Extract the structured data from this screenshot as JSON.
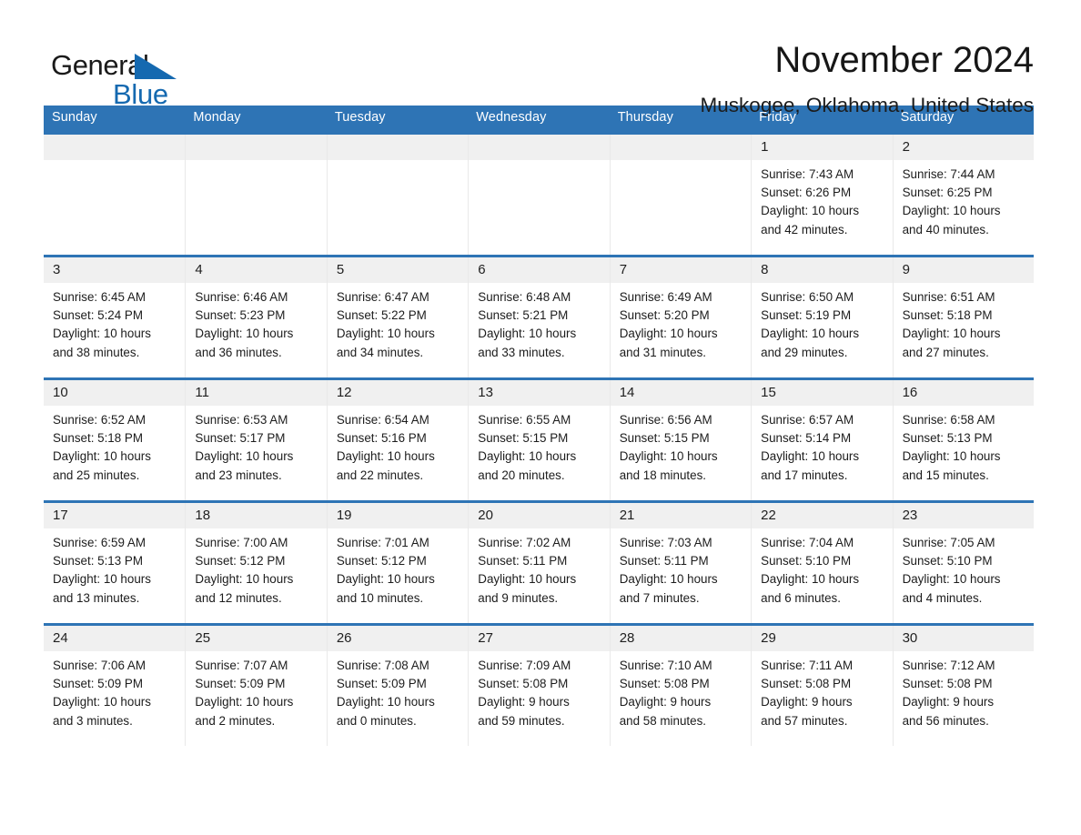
{
  "brand": {
    "name_part1": "General",
    "name_part2": "Blue",
    "accent_color": "#1569b0"
  },
  "header": {
    "title": "November 2024",
    "location": "Muskogee, Oklahoma, United States",
    "header_bg_color": "#2e74b5",
    "daynum_band_color": "#f0f0f0"
  },
  "weekdays": [
    "Sunday",
    "Monday",
    "Tuesday",
    "Wednesday",
    "Thursday",
    "Friday",
    "Saturday"
  ],
  "weeks": [
    [
      {
        "day": "",
        "sunrise": "",
        "sunset": "",
        "daylight1": "",
        "daylight2": ""
      },
      {
        "day": "",
        "sunrise": "",
        "sunset": "",
        "daylight1": "",
        "daylight2": ""
      },
      {
        "day": "",
        "sunrise": "",
        "sunset": "",
        "daylight1": "",
        "daylight2": ""
      },
      {
        "day": "",
        "sunrise": "",
        "sunset": "",
        "daylight1": "",
        "daylight2": ""
      },
      {
        "day": "",
        "sunrise": "",
        "sunset": "",
        "daylight1": "",
        "daylight2": ""
      },
      {
        "day": "1",
        "sunrise": "Sunrise: 7:43 AM",
        "sunset": "Sunset: 6:26 PM",
        "daylight1": "Daylight: 10 hours",
        "daylight2": "and 42 minutes."
      },
      {
        "day": "2",
        "sunrise": "Sunrise: 7:44 AM",
        "sunset": "Sunset: 6:25 PM",
        "daylight1": "Daylight: 10 hours",
        "daylight2": "and 40 minutes."
      }
    ],
    [
      {
        "day": "3",
        "sunrise": "Sunrise: 6:45 AM",
        "sunset": "Sunset: 5:24 PM",
        "daylight1": "Daylight: 10 hours",
        "daylight2": "and 38 minutes."
      },
      {
        "day": "4",
        "sunrise": "Sunrise: 6:46 AM",
        "sunset": "Sunset: 5:23 PM",
        "daylight1": "Daylight: 10 hours",
        "daylight2": "and 36 minutes."
      },
      {
        "day": "5",
        "sunrise": "Sunrise: 6:47 AM",
        "sunset": "Sunset: 5:22 PM",
        "daylight1": "Daylight: 10 hours",
        "daylight2": "and 34 minutes."
      },
      {
        "day": "6",
        "sunrise": "Sunrise: 6:48 AM",
        "sunset": "Sunset: 5:21 PM",
        "daylight1": "Daylight: 10 hours",
        "daylight2": "and 33 minutes."
      },
      {
        "day": "7",
        "sunrise": "Sunrise: 6:49 AM",
        "sunset": "Sunset: 5:20 PM",
        "daylight1": "Daylight: 10 hours",
        "daylight2": "and 31 minutes."
      },
      {
        "day": "8",
        "sunrise": "Sunrise: 6:50 AM",
        "sunset": "Sunset: 5:19 PM",
        "daylight1": "Daylight: 10 hours",
        "daylight2": "and 29 minutes."
      },
      {
        "day": "9",
        "sunrise": "Sunrise: 6:51 AM",
        "sunset": "Sunset: 5:18 PM",
        "daylight1": "Daylight: 10 hours",
        "daylight2": "and 27 minutes."
      }
    ],
    [
      {
        "day": "10",
        "sunrise": "Sunrise: 6:52 AM",
        "sunset": "Sunset: 5:18 PM",
        "daylight1": "Daylight: 10 hours",
        "daylight2": "and 25 minutes."
      },
      {
        "day": "11",
        "sunrise": "Sunrise: 6:53 AM",
        "sunset": "Sunset: 5:17 PM",
        "daylight1": "Daylight: 10 hours",
        "daylight2": "and 23 minutes."
      },
      {
        "day": "12",
        "sunrise": "Sunrise: 6:54 AM",
        "sunset": "Sunset: 5:16 PM",
        "daylight1": "Daylight: 10 hours",
        "daylight2": "and 22 minutes."
      },
      {
        "day": "13",
        "sunrise": "Sunrise: 6:55 AM",
        "sunset": "Sunset: 5:15 PM",
        "daylight1": "Daylight: 10 hours",
        "daylight2": "and 20 minutes."
      },
      {
        "day": "14",
        "sunrise": "Sunrise: 6:56 AM",
        "sunset": "Sunset: 5:15 PM",
        "daylight1": "Daylight: 10 hours",
        "daylight2": "and 18 minutes."
      },
      {
        "day": "15",
        "sunrise": "Sunrise: 6:57 AM",
        "sunset": "Sunset: 5:14 PM",
        "daylight1": "Daylight: 10 hours",
        "daylight2": "and 17 minutes."
      },
      {
        "day": "16",
        "sunrise": "Sunrise: 6:58 AM",
        "sunset": "Sunset: 5:13 PM",
        "daylight1": "Daylight: 10 hours",
        "daylight2": "and 15 minutes."
      }
    ],
    [
      {
        "day": "17",
        "sunrise": "Sunrise: 6:59 AM",
        "sunset": "Sunset: 5:13 PM",
        "daylight1": "Daylight: 10 hours",
        "daylight2": "and 13 minutes."
      },
      {
        "day": "18",
        "sunrise": "Sunrise: 7:00 AM",
        "sunset": "Sunset: 5:12 PM",
        "daylight1": "Daylight: 10 hours",
        "daylight2": "and 12 minutes."
      },
      {
        "day": "19",
        "sunrise": "Sunrise: 7:01 AM",
        "sunset": "Sunset: 5:12 PM",
        "daylight1": "Daylight: 10 hours",
        "daylight2": "and 10 minutes."
      },
      {
        "day": "20",
        "sunrise": "Sunrise: 7:02 AM",
        "sunset": "Sunset: 5:11 PM",
        "daylight1": "Daylight: 10 hours",
        "daylight2": "and 9 minutes."
      },
      {
        "day": "21",
        "sunrise": "Sunrise: 7:03 AM",
        "sunset": "Sunset: 5:11 PM",
        "daylight1": "Daylight: 10 hours",
        "daylight2": "and 7 minutes."
      },
      {
        "day": "22",
        "sunrise": "Sunrise: 7:04 AM",
        "sunset": "Sunset: 5:10 PM",
        "daylight1": "Daylight: 10 hours",
        "daylight2": "and 6 minutes."
      },
      {
        "day": "23",
        "sunrise": "Sunrise: 7:05 AM",
        "sunset": "Sunset: 5:10 PM",
        "daylight1": "Daylight: 10 hours",
        "daylight2": "and 4 minutes."
      }
    ],
    [
      {
        "day": "24",
        "sunrise": "Sunrise: 7:06 AM",
        "sunset": "Sunset: 5:09 PM",
        "daylight1": "Daylight: 10 hours",
        "daylight2": "and 3 minutes."
      },
      {
        "day": "25",
        "sunrise": "Sunrise: 7:07 AM",
        "sunset": "Sunset: 5:09 PM",
        "daylight1": "Daylight: 10 hours",
        "daylight2": "and 2 minutes."
      },
      {
        "day": "26",
        "sunrise": "Sunrise: 7:08 AM",
        "sunset": "Sunset: 5:09 PM",
        "daylight1": "Daylight: 10 hours",
        "daylight2": "and 0 minutes."
      },
      {
        "day": "27",
        "sunrise": "Sunrise: 7:09 AM",
        "sunset": "Sunset: 5:08 PM",
        "daylight1": "Daylight: 9 hours",
        "daylight2": "and 59 minutes."
      },
      {
        "day": "28",
        "sunrise": "Sunrise: 7:10 AM",
        "sunset": "Sunset: 5:08 PM",
        "daylight1": "Daylight: 9 hours",
        "daylight2": "and 58 minutes."
      },
      {
        "day": "29",
        "sunrise": "Sunrise: 7:11 AM",
        "sunset": "Sunset: 5:08 PM",
        "daylight1": "Daylight: 9 hours",
        "daylight2": "and 57 minutes."
      },
      {
        "day": "30",
        "sunrise": "Sunrise: 7:12 AM",
        "sunset": "Sunset: 5:08 PM",
        "daylight1": "Daylight: 9 hours",
        "daylight2": "and 56 minutes."
      }
    ]
  ]
}
